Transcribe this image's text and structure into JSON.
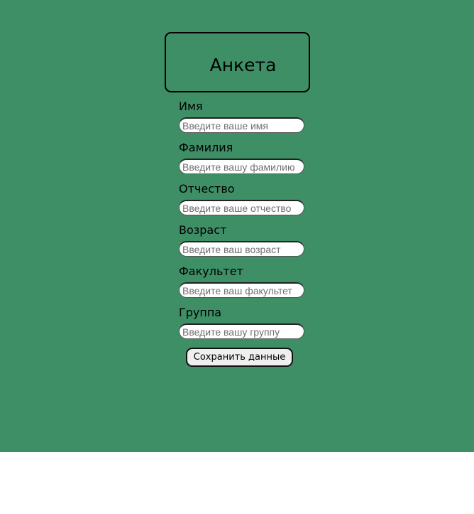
{
  "header": {
    "title": "Анкета"
  },
  "form": {
    "fields": [
      {
        "label": "Имя",
        "placeholder": "Введите ваше имя"
      },
      {
        "label": "Фамилия",
        "placeholder": "Введите вашу фамилию"
      },
      {
        "label": "Отчество",
        "placeholder": "Введите ваше отчество"
      },
      {
        "label": "Возраст",
        "placeholder": "Введите ваш возраст"
      },
      {
        "label": "Факультет",
        "placeholder": "Введите ваш факультет"
      },
      {
        "label": "Группа",
        "placeholder": "Введите вашу группу"
      }
    ],
    "submit_label": "Сохранить данные"
  },
  "colors": {
    "background": "#3e8e66",
    "below_page": "#ffffff"
  }
}
